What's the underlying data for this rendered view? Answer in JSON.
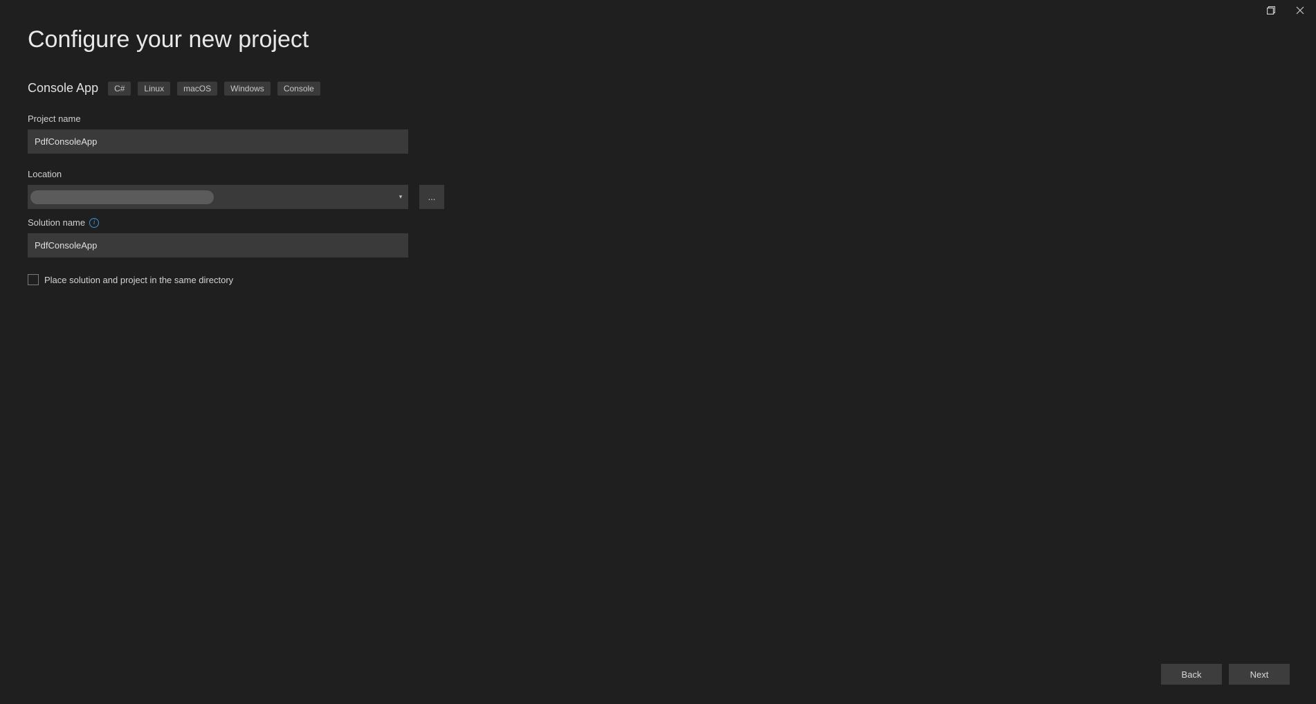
{
  "titlebar": {
    "maximize_tooltip": "Maximize",
    "close_tooltip": "Close"
  },
  "header": {
    "title": "Configure your new project"
  },
  "template": {
    "name": "Console App",
    "tags": [
      "C#",
      "Linux",
      "macOS",
      "Windows",
      "Console"
    ]
  },
  "fields": {
    "project_name": {
      "label": "Project name",
      "value": "PdfConsoleApp"
    },
    "location": {
      "label": "Location",
      "value": "",
      "browse_label": "..."
    },
    "solution_name": {
      "label": "Solution name",
      "value": "PdfConsoleApp",
      "info_tooltip": "Solution name information"
    },
    "same_dir": {
      "label": "Place solution and project in the same directory",
      "checked": false
    }
  },
  "footer": {
    "back_label": "Back",
    "next_label": "Next"
  }
}
